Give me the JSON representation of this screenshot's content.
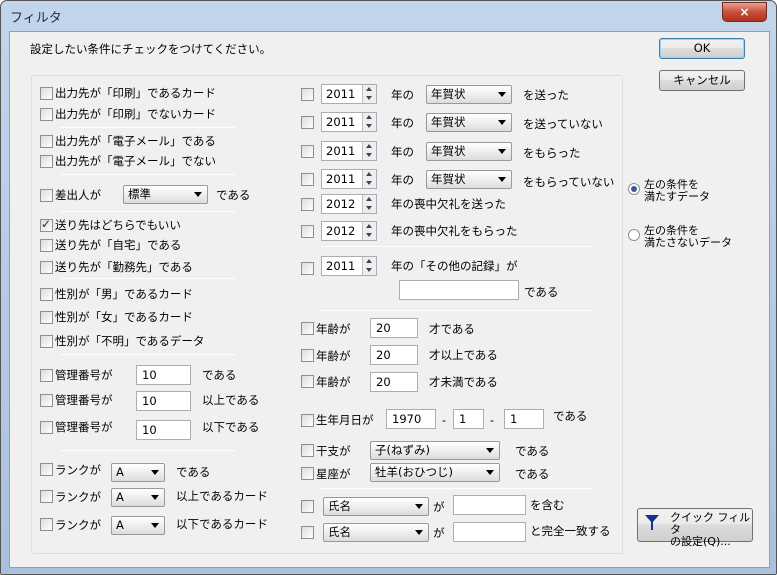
{
  "window": {
    "title": "フィルタ",
    "close_icon": "×"
  },
  "instruction": "設定したい条件にチェックをつけてください。",
  "buttons": {
    "ok": "OK",
    "cancel": "キャンセル",
    "quick_line1": "クイック フィルタ",
    "quick_line2": "の設定(Q)..."
  },
  "radios": {
    "match_line1": "左の条件を",
    "match_line2": "満たすデータ",
    "nomatch_line1": "左の条件を",
    "nomatch_line2": "満たさないデータ"
  },
  "left": {
    "print_yes": "出力先が「印刷」であるカード",
    "print_no": "出力先が「印刷」でないカード",
    "email_yes": "出力先が「電子メール」である",
    "email_no": "出力先が「電子メール」でない",
    "sender_label": "差出人が",
    "sender_value": "標準",
    "sender_suffix": "である",
    "dest_any": "送り先はどちらでもいい",
    "dest_home": "送り先が「自宅」である",
    "dest_work": "送り先が「勤務先」である",
    "sex_male": "性別が「男」であるカード",
    "sex_female": "性別が「女」であるカード",
    "sex_unknown": "性別が「不明」であるデータ",
    "mgmt_label": "管理番号が",
    "mgmt_value": "10",
    "mgmt_eq": "である",
    "mgmt_ge": "以上である",
    "mgmt_le": "以下である",
    "rank_label": "ランクが",
    "rank_value": "A",
    "rank_eq": "である",
    "rank_ge": "以上であるカード",
    "rank_le": "以下であるカード"
  },
  "right": {
    "year1": "2011",
    "year2": "2011",
    "year3": "2011",
    "year4": "2011",
    "year5": "2012",
    "year6": "2012",
    "year7": "2011",
    "year_of": "年の",
    "card_type": "年賀状",
    "sent": "を送った",
    "not_sent": "を送っていない",
    "received": "をもらった",
    "not_received": "をもらっていない",
    "mourning_sent": "年の喪中欠礼を送った",
    "mourning_received": "年の喪中欠礼をもらった",
    "other_record": "年の「その他の記録」が",
    "other_record_value": "",
    "other_suffix": "である",
    "age_label": "年齢が",
    "age_value": "20",
    "age_eq": "才である",
    "age_ge": "才以上である",
    "age_lt": "才未満である",
    "birth_label": "生年月日が",
    "birth_year": "1970",
    "birth_month": "1",
    "birth_day": "1",
    "dash": "-",
    "birth_suffix": "である",
    "eto_label": "干支が",
    "eto_value": "子(ねずみ)",
    "eto_suffix": "である",
    "zodiac_label": "星座が",
    "zodiac_value": "牡羊(おひつじ)",
    "zodiac_suffix": "である",
    "field_value": "氏名",
    "ga": "が",
    "text_value": "",
    "contains": "を含む",
    "exact": "と完全一致する"
  }
}
